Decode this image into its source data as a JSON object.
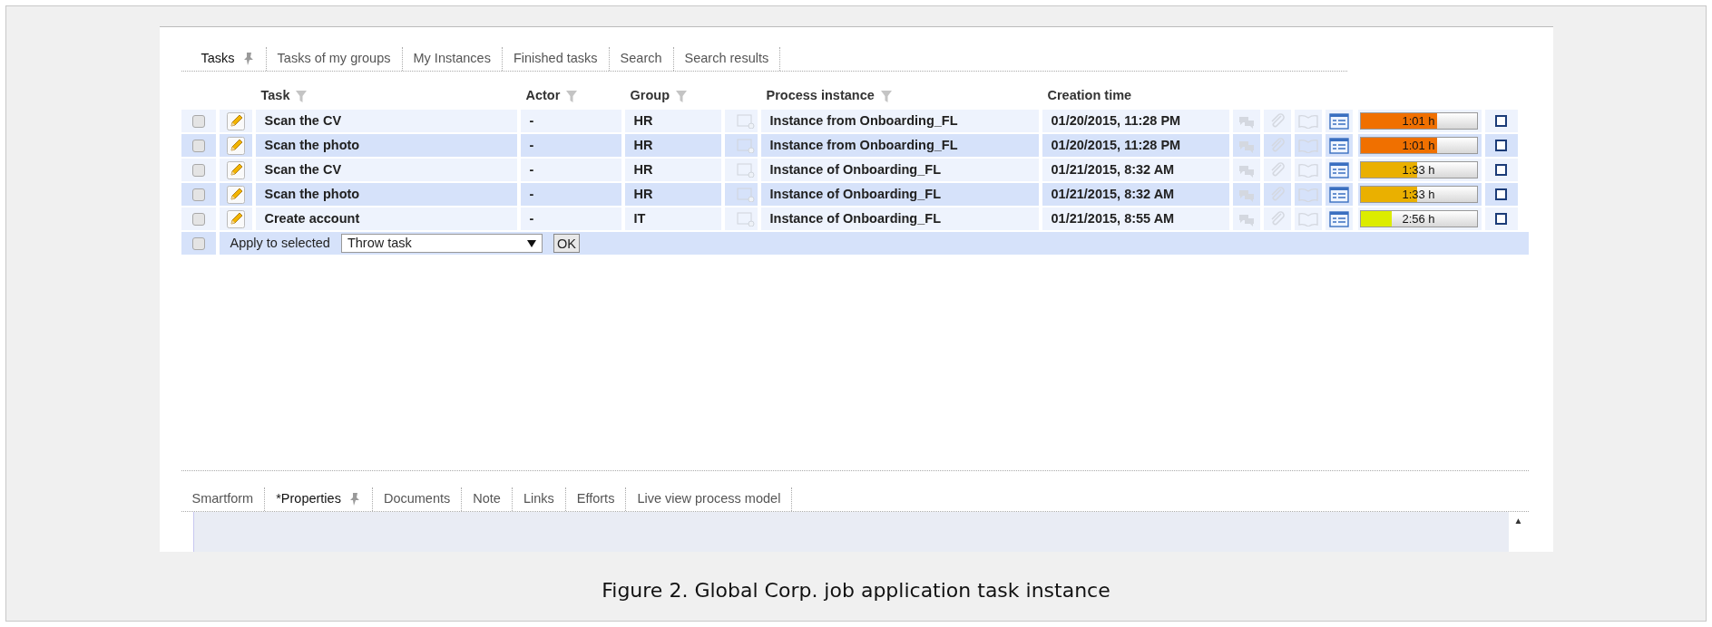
{
  "top_tabs": [
    {
      "label": "Tasks",
      "selected": true,
      "pinned": true
    },
    {
      "label": "Tasks of my groups",
      "selected": false,
      "pinned": false
    },
    {
      "label": "My Instances",
      "selected": false,
      "pinned": false
    },
    {
      "label": "Finished tasks",
      "selected": false,
      "pinned": false
    },
    {
      "label": "Search",
      "selected": false,
      "pinned": false
    },
    {
      "label": "Search results",
      "selected": false,
      "pinned": false
    }
  ],
  "table": {
    "columns": [
      {
        "label": "Task",
        "filter": true
      },
      {
        "label": "Actor",
        "filter": true
      },
      {
        "label": "Group",
        "filter": true
      },
      {
        "label": "Process instance",
        "filter": true
      },
      {
        "label": "Creation time",
        "filter": false
      }
    ],
    "rows": [
      {
        "checked": false,
        "task": "Scan the CV",
        "actor": "-",
        "group": "HR",
        "process": "Instance from Onboarding_FL",
        "created": "01/20/2015, 11:28 PM",
        "remaining": "1:01 h",
        "level": 0.66,
        "color": "#f07000",
        "selected": false
      },
      {
        "checked": false,
        "task": "Scan the photo",
        "actor": "-",
        "group": "HR",
        "process": "Instance from Onboarding_FL",
        "created": "01/20/2015, 11:28 PM",
        "remaining": "1:01 h",
        "level": 0.66,
        "color": "#f07000",
        "selected": false
      },
      {
        "checked": false,
        "task": "Scan the CV",
        "actor": "-",
        "group": "HR",
        "process": "Instance of Onboarding_FL",
        "created": "01/21/2015, 8:32 AM",
        "remaining": "1:33 h",
        "level": 0.49,
        "color": "#eab000",
        "selected": false
      },
      {
        "checked": false,
        "task": "Scan the photo",
        "actor": "-",
        "group": "HR",
        "process": "Instance of Onboarding_FL",
        "created": "01/21/2015, 8:32 AM",
        "remaining": "1:33 h",
        "level": 0.49,
        "color": "#eab000",
        "selected": false
      },
      {
        "checked": false,
        "task": "Create account",
        "actor": "-",
        "group": "IT",
        "process": "Instance of Onboarding_FL",
        "created": "01/21/2015, 8:55 AM",
        "remaining": "2:56 h",
        "level": 0.27,
        "color": "#dcec00",
        "selected": false
      }
    ],
    "apply": {
      "checked": false,
      "label": "Apply to selected",
      "action": "Throw task",
      "button": "OK"
    }
  },
  "bottom_tabs": [
    {
      "label": "Smartform",
      "selected": false,
      "pinned": false
    },
    {
      "label": "*Properties",
      "selected": true,
      "pinned": true
    },
    {
      "label": "Documents",
      "selected": false,
      "pinned": false
    },
    {
      "label": "Note",
      "selected": false,
      "pinned": false
    },
    {
      "label": "Links",
      "selected": false,
      "pinned": false
    },
    {
      "label": "Efforts",
      "selected": false,
      "pinned": false
    },
    {
      "label": "Live view process model",
      "selected": false,
      "pinned": false
    }
  ],
  "scroll_arrow": "▲",
  "caption": "Figure 2. Global Corp. job application task instance"
}
